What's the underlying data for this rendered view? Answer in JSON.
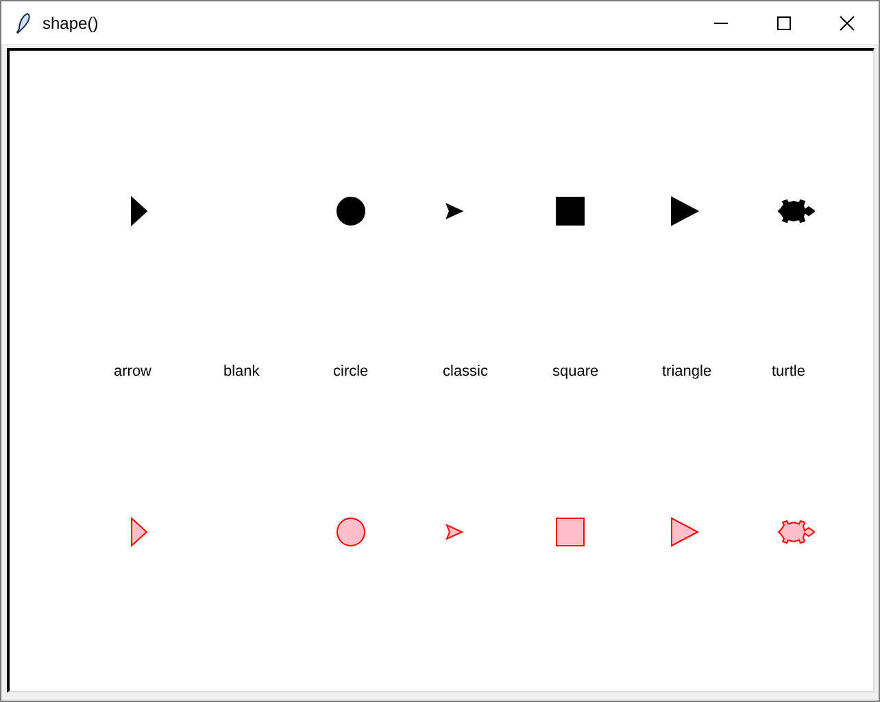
{
  "window": {
    "title": "shape()"
  },
  "shapes": [
    {
      "name": "arrow",
      "kind": "arrow"
    },
    {
      "name": "blank",
      "kind": "blank"
    },
    {
      "name": "circle",
      "kind": "circle"
    },
    {
      "name": "classic",
      "kind": "classic"
    },
    {
      "name": "square",
      "kind": "square"
    },
    {
      "name": "triangle",
      "kind": "triangle"
    },
    {
      "name": "turtle",
      "kind": "turtle"
    }
  ],
  "stamp_rows": [
    {
      "kind": "solid",
      "color": "#000000"
    },
    {
      "kind": "tinted",
      "color": "#ff0000"
    }
  ]
}
